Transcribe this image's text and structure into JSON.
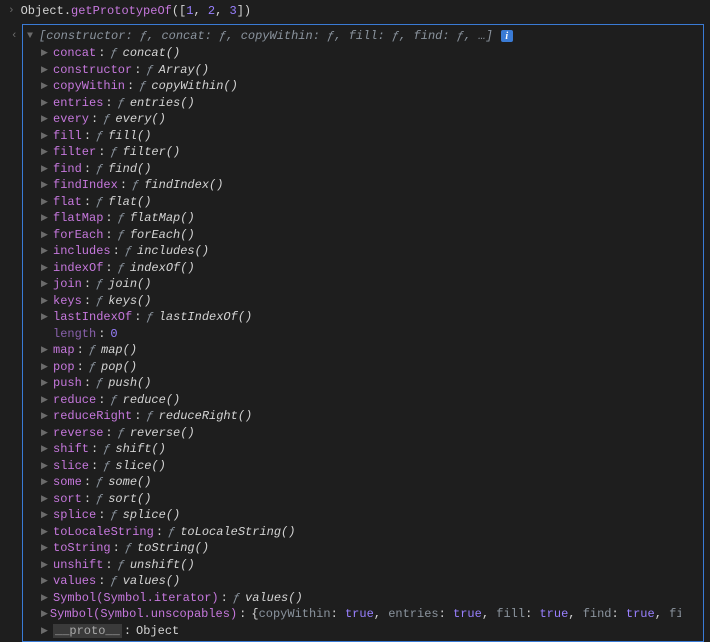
{
  "input": {
    "object": "Object",
    "method": "getPrototypeOf",
    "args_open": "([",
    "args": [
      "1",
      "2",
      "3"
    ],
    "args_close": "])"
  },
  "summary": {
    "prefix": "[",
    "pairs": [
      {
        "k": "constructor",
        "v": "ƒ"
      },
      {
        "k": "concat",
        "v": "ƒ"
      },
      {
        "k": "copyWithin",
        "v": "ƒ"
      },
      {
        "k": "fill",
        "v": "ƒ"
      },
      {
        "k": "find",
        "v": "ƒ"
      }
    ],
    "suffix": ", …]"
  },
  "props": [
    {
      "key": "concat",
      "fn": "concat()"
    },
    {
      "key": "constructor",
      "fn": "Array()"
    },
    {
      "key": "copyWithin",
      "fn": "copyWithin()"
    },
    {
      "key": "entries",
      "fn": "entries()"
    },
    {
      "key": "every",
      "fn": "every()"
    },
    {
      "key": "fill",
      "fn": "fill()"
    },
    {
      "key": "filter",
      "fn": "filter()"
    },
    {
      "key": "find",
      "fn": "find()"
    },
    {
      "key": "findIndex",
      "fn": "findIndex()"
    },
    {
      "key": "flat",
      "fn": "flat()"
    },
    {
      "key": "flatMap",
      "fn": "flatMap()"
    },
    {
      "key": "forEach",
      "fn": "forEach()"
    },
    {
      "key": "includes",
      "fn": "includes()"
    },
    {
      "key": "indexOf",
      "fn": "indexOf()"
    },
    {
      "key": "join",
      "fn": "join()"
    },
    {
      "key": "keys",
      "fn": "keys()"
    },
    {
      "key": "lastIndexOf",
      "fn": "lastIndexOf()"
    }
  ],
  "length": {
    "key": "length",
    "value": "0"
  },
  "props2": [
    {
      "key": "map",
      "fn": "map()"
    },
    {
      "key": "pop",
      "fn": "pop()"
    },
    {
      "key": "push",
      "fn": "push()"
    },
    {
      "key": "reduce",
      "fn": "reduce()"
    },
    {
      "key": "reduceRight",
      "fn": "reduceRight()"
    },
    {
      "key": "reverse",
      "fn": "reverse()"
    },
    {
      "key": "shift",
      "fn": "shift()"
    },
    {
      "key": "slice",
      "fn": "slice()"
    },
    {
      "key": "some",
      "fn": "some()"
    },
    {
      "key": "sort",
      "fn": "sort()"
    },
    {
      "key": "splice",
      "fn": "splice()"
    },
    {
      "key": "toLocaleString",
      "fn": "toLocaleString()"
    },
    {
      "key": "toString",
      "fn": "toString()"
    },
    {
      "key": "unshift",
      "fn": "unshift()"
    },
    {
      "key": "values",
      "fn": "values()"
    },
    {
      "key": "Symbol(Symbol.iterator)",
      "fn": "values()"
    }
  ],
  "unscopables": {
    "key": "Symbol(Symbol.unscopables)",
    "brace_open": "{",
    "pairs": [
      {
        "k": "copyWithin",
        "v": "true"
      },
      {
        "k": "entries",
        "v": "true"
      },
      {
        "k": "fill",
        "v": "true"
      },
      {
        "k": "find",
        "v": "true"
      },
      {
        "k": "findIndex",
        "v": "true"
      }
    ],
    "suffix": ", …}"
  },
  "proto": {
    "key": "__proto__",
    "value": "Object"
  },
  "glyphs": {
    "prompt": "›",
    "result": "‹",
    "caret_down": "▼",
    "caret_right": "▶",
    "fn": "ƒ",
    "info": "i"
  }
}
